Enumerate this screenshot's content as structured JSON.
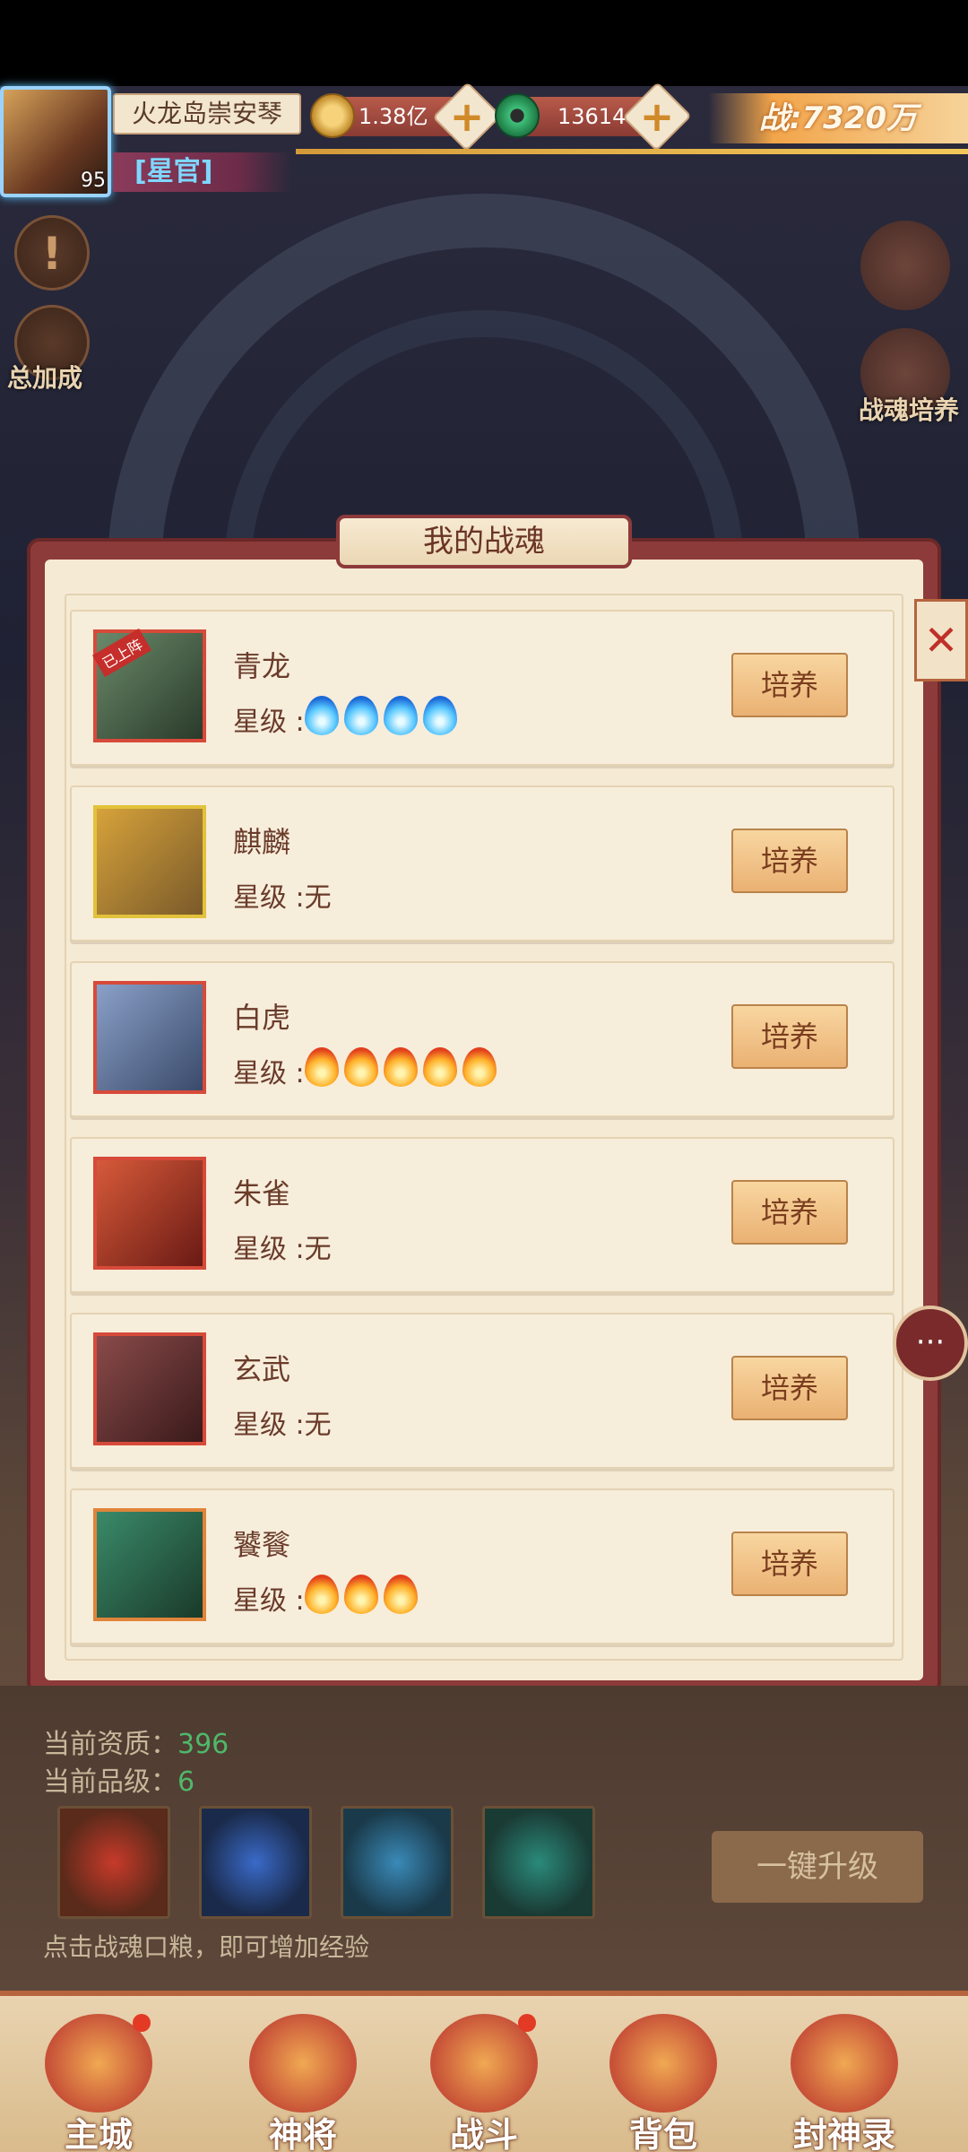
{
  "header": {
    "avatar_level": "95",
    "player_name": "火龙岛崇安琴",
    "title": "[星官]",
    "coins": "1.38亿",
    "jade": "13614",
    "power": "战:7320万"
  },
  "side": {
    "total_bonus": "总加成",
    "soul_train": "战魂培养"
  },
  "dialog": {
    "title": "我的战魂",
    "close": "✕",
    "star_prefix": "星级 :",
    "train_label": "培养",
    "rows": [
      {
        "name": "青龙",
        "star_text": "",
        "badge": "已上阵",
        "flame_type": "blue",
        "flames": 4
      },
      {
        "name": "麒麟",
        "star_text": "无",
        "badge": "",
        "flame_type": "",
        "flames": 0
      },
      {
        "name": "白虎",
        "star_text": "",
        "badge": "",
        "flame_type": "orange",
        "flames": 5
      },
      {
        "name": "朱雀",
        "star_text": "无",
        "badge": "",
        "flame_type": "",
        "flames": 0
      },
      {
        "name": "玄武",
        "star_text": "无",
        "badge": "",
        "flame_type": "",
        "flames": 0
      },
      {
        "name": "饕餮",
        "star_text": "",
        "badge": "",
        "flame_type": "orange",
        "flames": 3
      }
    ]
  },
  "info": {
    "aptitude_label": "当前资质：",
    "aptitude_value": "396",
    "grade_label": "当前品级：",
    "grade_value": "6",
    "upgrade_button": "一键升级",
    "hint": "点击战魂口粮，即可增加经验"
  },
  "nav": {
    "items": [
      "主城",
      "神将",
      "战斗",
      "背包",
      "封神录"
    ]
  },
  "colors": {
    "dialog_frame": "#8d3a3a",
    "panel_bg": "#f5ead4",
    "train_button": "#eab173"
  }
}
